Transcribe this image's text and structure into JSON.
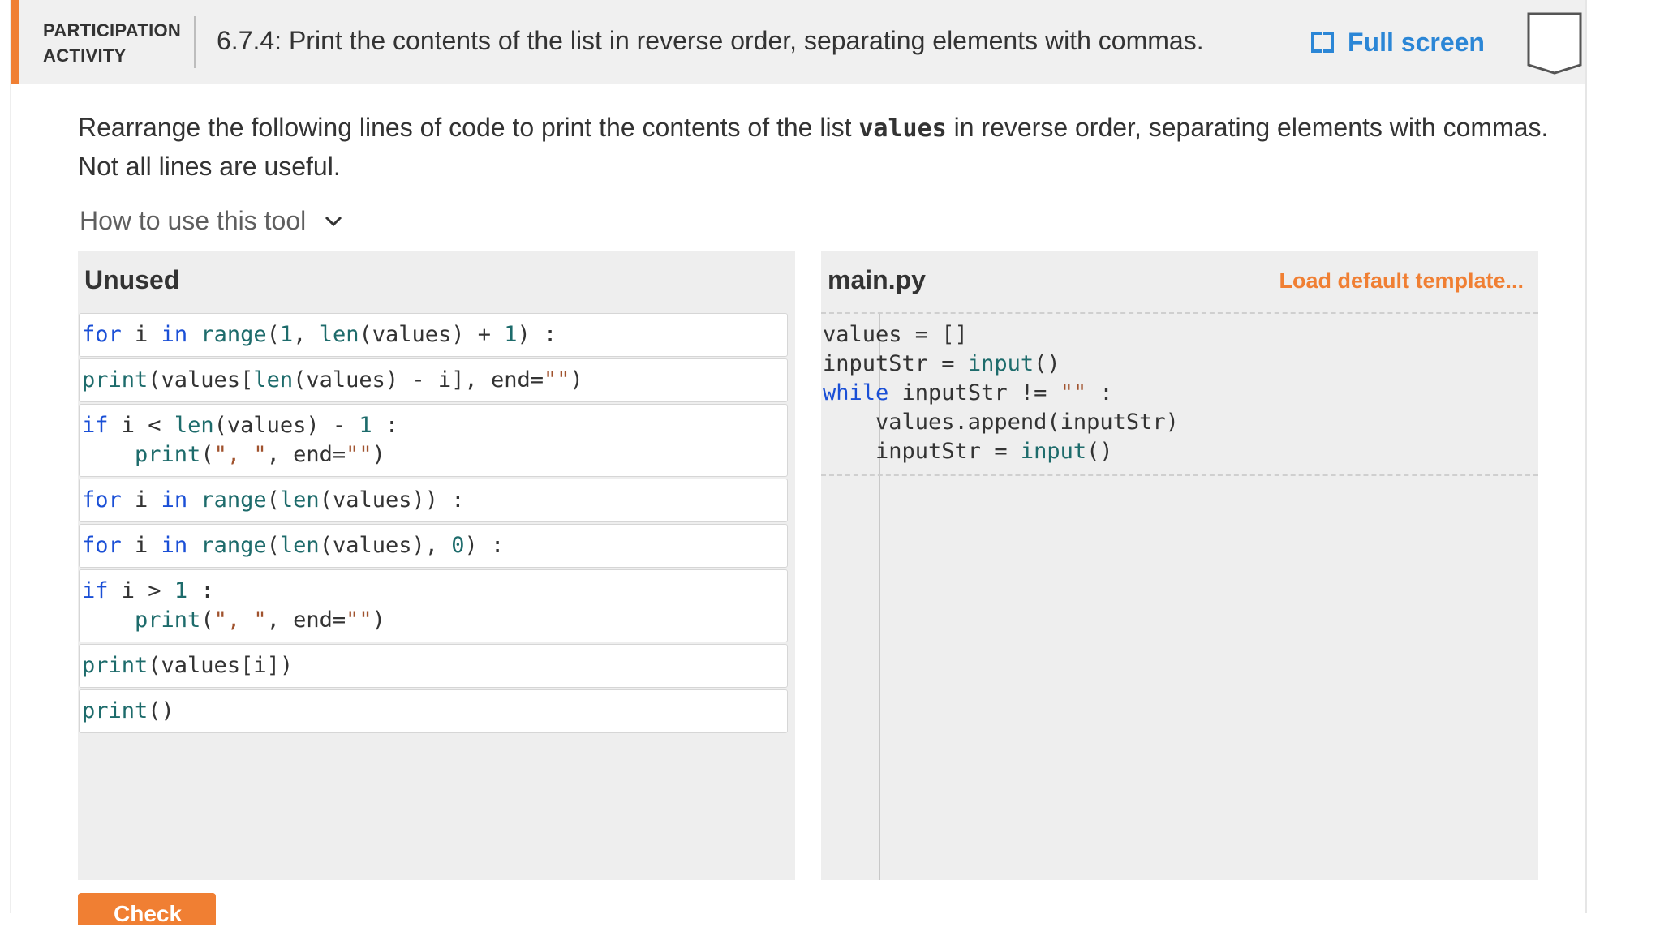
{
  "header": {
    "activity_label_line1": "PARTICIPATION",
    "activity_label_line2": "ACTIVITY",
    "title": "6.7.4: Print the contents of the list in reverse order, separating elements with commas.",
    "fullscreen_label": "Full screen"
  },
  "instructions": {
    "before": "Rearrange the following lines of code to print the contents of the list ",
    "code": "values",
    "after": " in reverse order, separating elements with commas. Not all lines are useful."
  },
  "howto": {
    "label": "How to use this tool"
  },
  "unused": {
    "title": "Unused",
    "blocks": [
      {
        "lines": [
          "for i in range(1, len(values) + 1) :"
        ]
      },
      {
        "lines": [
          "print(values[len(values) - i], end=\"\")"
        ]
      },
      {
        "lines": [
          "if i < len(values) - 1 :",
          "    print(\", \", end=\"\")"
        ]
      },
      {
        "lines": [
          "for i in range(len(values)) :"
        ]
      },
      {
        "lines": [
          "for i in range(len(values), 0) :"
        ]
      },
      {
        "lines": [
          "if i > 1 :",
          "    print(\", \", end=\"\")"
        ]
      },
      {
        "lines": [
          "print(values[i])"
        ]
      },
      {
        "lines": [
          "print()"
        ]
      }
    ]
  },
  "main": {
    "title": "main.py",
    "load_template_label": "Load default template...",
    "lines": [
      "values = []",
      "inputStr = input()",
      "while inputStr != \"\" :",
      "    values.append(inputStr)",
      "    inputStr = input()"
    ]
  },
  "check_button": {
    "label": "Check"
  },
  "colors": {
    "accent": "#f07f33",
    "link": "#2b86d6",
    "keyword": "#1a4fd6",
    "function": "#1d6b6b"
  },
  "icons": [
    "fullscreen-icon",
    "bookmark-icon",
    "chevron-down-icon"
  ]
}
